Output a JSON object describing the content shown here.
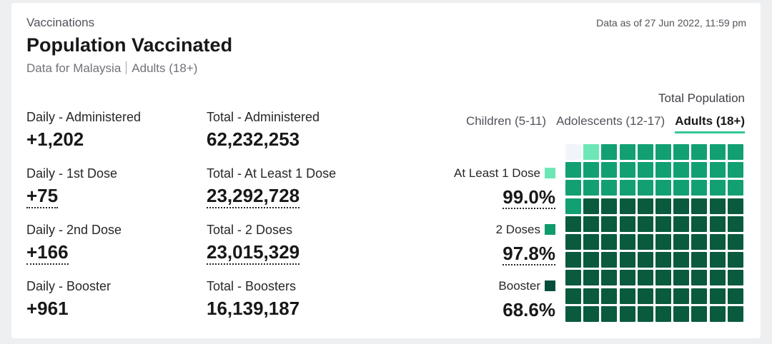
{
  "header": {
    "eyebrow": "Vaccinations",
    "title": "Population Vaccinated",
    "subtitle_region": "Data for Malaysia",
    "subtitle_group": "Adults (18+)",
    "as_of": "Data as of 27 Jun 2022, 11:59 pm"
  },
  "daily": [
    {
      "label": "Daily - Administered",
      "value": "+1,202"
    },
    {
      "label": "Daily - 1st Dose",
      "value": "+75"
    },
    {
      "label": "Daily - 2nd Dose",
      "value": "+166"
    },
    {
      "label": "Daily - Booster",
      "value": "+961"
    }
  ],
  "total": [
    {
      "label": "Total - Administered",
      "value": "62,232,253"
    },
    {
      "label": "Total - At Least 1 Dose",
      "value": "23,292,728"
    },
    {
      "label": "Total - 2 Doses",
      "value": "23,015,329"
    },
    {
      "label": "Total - Boosters",
      "value": "16,139,187"
    }
  ],
  "population": {
    "title": "Total Population",
    "tabs": [
      "Children (5-11)",
      "Adolescents (12-17)",
      "Adults (18+)"
    ],
    "active_tab": "Adults (18+)"
  },
  "legend": [
    {
      "label": "At Least 1 Dose",
      "value": "99.0%",
      "color": "#6ee7b7"
    },
    {
      "label": "2 Doses",
      "value": "97.8%",
      "color": "#109b6b"
    },
    {
      "label": "Booster",
      "value": "68.6%",
      "color": "#064e3b"
    }
  ],
  "chart_data": {
    "type": "waffle",
    "grid": [
      10,
      10
    ],
    "series": [
      {
        "name": "At Least 1 Dose",
        "value": 99.0
      },
      {
        "name": "2 Doses",
        "value": 97.8
      },
      {
        "name": "Booster",
        "value": 68.6
      }
    ],
    "colors": {
      "booster": "#0a5a3e",
      "two_doses": "#12a073",
      "one_dose": "#6ee7b7",
      "none": "#f1f5f9"
    }
  }
}
